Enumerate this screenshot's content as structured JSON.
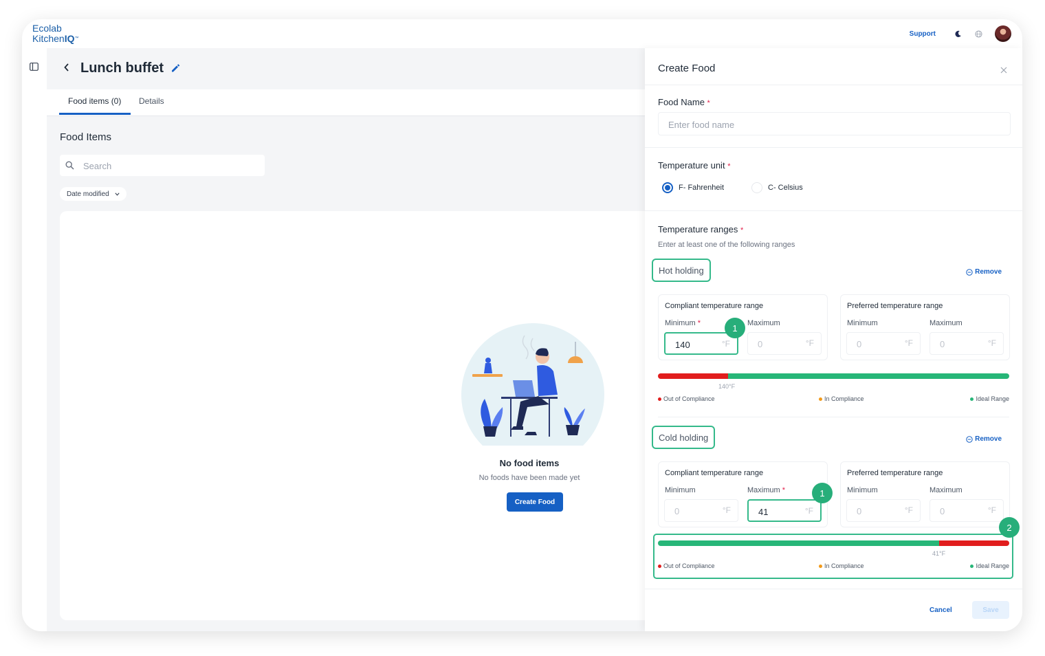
{
  "app": {
    "logo_line1": "Ecolab",
    "logo_line2a": "Kitchen",
    "logo_line2b": "IQ",
    "logo_tm": "™",
    "support_label": "Support"
  },
  "page": {
    "title": "Lunch buffet",
    "tabs": [
      {
        "label": "Food items (0)",
        "active": true
      },
      {
        "label": "Details",
        "active": false
      }
    ],
    "section_title": "Food Items",
    "search_placeholder": "Search",
    "sort_label": "Date modified",
    "empty": {
      "title": "No food items",
      "subtitle": "No foods have been made yet",
      "button": "Create Food"
    }
  },
  "panel": {
    "title": "Create Food",
    "food_name_label": "Food Name",
    "food_name_placeholder": "Enter food name",
    "required_mark": "*",
    "temp_unit_label": "Temperature unit",
    "units": [
      {
        "label": "F- Fahrenheit",
        "selected": true
      },
      {
        "label": "C- Celsius",
        "selected": false
      }
    ],
    "temp_ranges_label": "Temperature ranges",
    "temp_ranges_hint": "Enter at least one of the following ranges",
    "remove_label": "Remove",
    "compliant_title": "Compliant temperature range",
    "preferred_title": "Preferred temperature range",
    "minimum_label": "Minimum",
    "maximum_label": "Maximum",
    "unit_suffix": "°F",
    "placeholder_zero": "0",
    "legend": [
      {
        "label": "Out of Compliance",
        "color": "#e11d1d"
      },
      {
        "label": "In Compliance",
        "color": "#f29a1b"
      },
      {
        "label": "Ideal Range",
        "color": "#27b678"
      }
    ],
    "hot": {
      "name": "Hot holding",
      "compliant_min": "140",
      "compliant_max": "",
      "bar_marker_label": "140°F",
      "out_fraction": 0.2
    },
    "cold": {
      "name": "Cold holding",
      "compliant_min": "",
      "compliant_max": "41",
      "bar_marker_label": "41°F",
      "in_fraction": 0.8
    },
    "callouts": [
      "1",
      "1",
      "2"
    ],
    "cancel_label": "Cancel",
    "save_label": "Save",
    "colors": {
      "red": "#e11d1d",
      "green": "#27b678",
      "accent": "#1660c4"
    }
  }
}
